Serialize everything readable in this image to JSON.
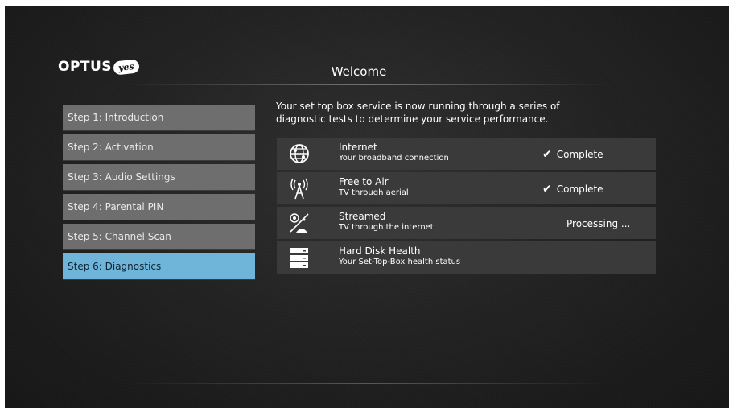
{
  "brand": {
    "wordmark": "OPTUS",
    "badge": "yes"
  },
  "header": {
    "title": "Welcome"
  },
  "steps": [
    {
      "label": "Step 1: Introduction",
      "active": false
    },
    {
      "label": "Step 2: Activation",
      "active": false
    },
    {
      "label": "Step 3: Audio Settings",
      "active": false
    },
    {
      "label": "Step 4: Parental PIN",
      "active": false
    },
    {
      "label": "Step 5: Channel Scan",
      "active": false
    },
    {
      "label": "Step 6: Diagnostics",
      "active": true
    }
  ],
  "intro": {
    "line1": "Your set top box service is now running through a series of",
    "line2": "diagnostic tests to determine your service performance."
  },
  "tests": [
    {
      "icon": "globe-icon",
      "name": "Internet",
      "desc": "Your broadband connection",
      "status": "Complete",
      "tick": "✔"
    },
    {
      "icon": "antenna-icon",
      "name": "Free to Air",
      "desc": "TV through aerial",
      "status": "Complete",
      "tick": "✔"
    },
    {
      "icon": "streaming-icon",
      "name": "Streamed",
      "desc": "TV through the internet",
      "status": "Processing ...",
      "tick": ""
    },
    {
      "icon": "hard-disk-icon",
      "name": "Hard Disk Health",
      "desc": "Your Set-Top-Box health status",
      "status": "",
      "tick": ""
    }
  ],
  "colors": {
    "active_step": "#6fb5d9",
    "step_bg": "#6e6e6e",
    "row_bg": "#3a3a3a"
  }
}
